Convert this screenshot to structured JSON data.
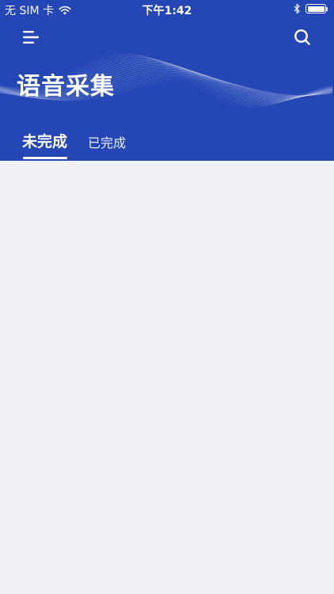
{
  "status_bar": {
    "carrier": "无 SIM 卡",
    "time": "下午1:42"
  },
  "header": {
    "title": "语音采集",
    "menu_icon": "menu-icon",
    "search_icon": "search-icon"
  },
  "tabs": [
    {
      "label": "未完成",
      "active": true
    },
    {
      "label": "已完成",
      "active": false
    }
  ],
  "colors": {
    "header_bg": "#2547b6",
    "content_bg": "#f0f1f5",
    "text_on_header": "#ffffff"
  }
}
